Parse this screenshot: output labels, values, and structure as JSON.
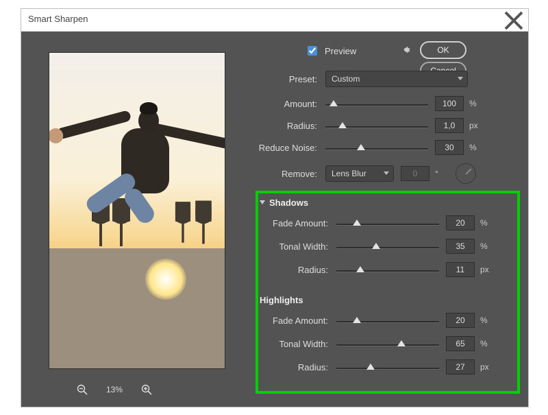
{
  "window": {
    "title": "Smart Sharpen"
  },
  "preview": {
    "label": "Preview",
    "checked": true
  },
  "buttons": {
    "ok": "OK",
    "cancel": "Cancel"
  },
  "labels": {
    "preset": "Preset:",
    "amount": "Amount:",
    "radius": "Radius:",
    "reduce_noise": "Reduce Noise:",
    "remove": "Remove:",
    "fade_amount": "Fade Amount:",
    "tonal_width": "Tonal Width:"
  },
  "units": {
    "percent": "%",
    "px": "px",
    "deg": "°"
  },
  "preset": {
    "value": "Custom"
  },
  "amount": {
    "value": "100",
    "pos": 12
  },
  "radius": {
    "value": "1,0",
    "pos": 25
  },
  "reduce_noise": {
    "value": "30",
    "pos": 52
  },
  "remove": {
    "mode": "Lens Blur",
    "angle": "0"
  },
  "sections": {
    "shadows": "Shadows",
    "highlights": "Highlights"
  },
  "shadows": {
    "fade_amount": {
      "value": "20",
      "pos": 30
    },
    "tonal_width": {
      "value": "35",
      "pos": 58
    },
    "radius": {
      "value": "11",
      "pos": 35
    }
  },
  "highlights": {
    "fade_amount": {
      "value": "20",
      "pos": 30
    },
    "tonal_width": {
      "value": "65",
      "pos": 95
    },
    "radius": {
      "value": "27",
      "pos": 50
    }
  },
  "zoom": {
    "level": "13%"
  }
}
